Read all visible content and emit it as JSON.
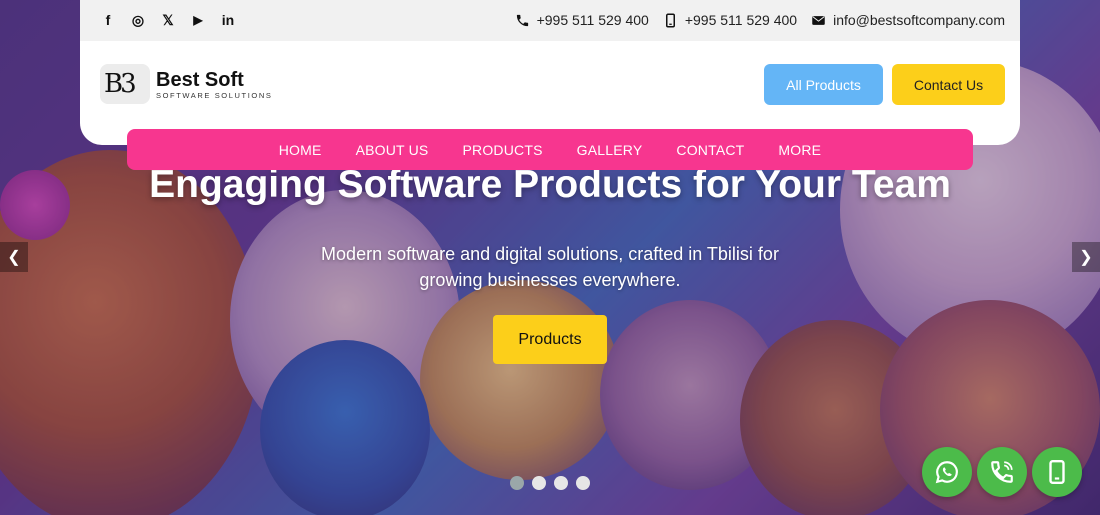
{
  "social": {
    "facebook": "f",
    "instagram": "◎",
    "x": "𝕏",
    "youtube": "▶",
    "linkedin": "in"
  },
  "contacts": {
    "phone1": "+995 511 529 400",
    "phone2": "+995 511 529 400",
    "email": "info@bestsoftcompany.com"
  },
  "logo": {
    "mark": "B3",
    "name": "Best Soft",
    "tagline": "SOFTWARE SOLUTIONS"
  },
  "header_buttons": {
    "all_products": "All Products",
    "contact_us": "Contact Us"
  },
  "nav": {
    "items": [
      "HOME",
      "ABOUT US",
      "PRODUCTS",
      "GALLERY",
      "CONTACT",
      "MORE"
    ]
  },
  "hero": {
    "headline": "Engaging Software Products for Your Team",
    "subtitle": "Modern software and digital solutions, crafted in Tbilisi for growing businesses everywhere.",
    "cta": "Products",
    "slide_count": 4,
    "active_slide": 1
  },
  "colors": {
    "nav": "#f7368f",
    "accent_yellow": "#fccf1a",
    "accent_blue": "#64b5f6",
    "fab_green": "#4cbb4a"
  }
}
